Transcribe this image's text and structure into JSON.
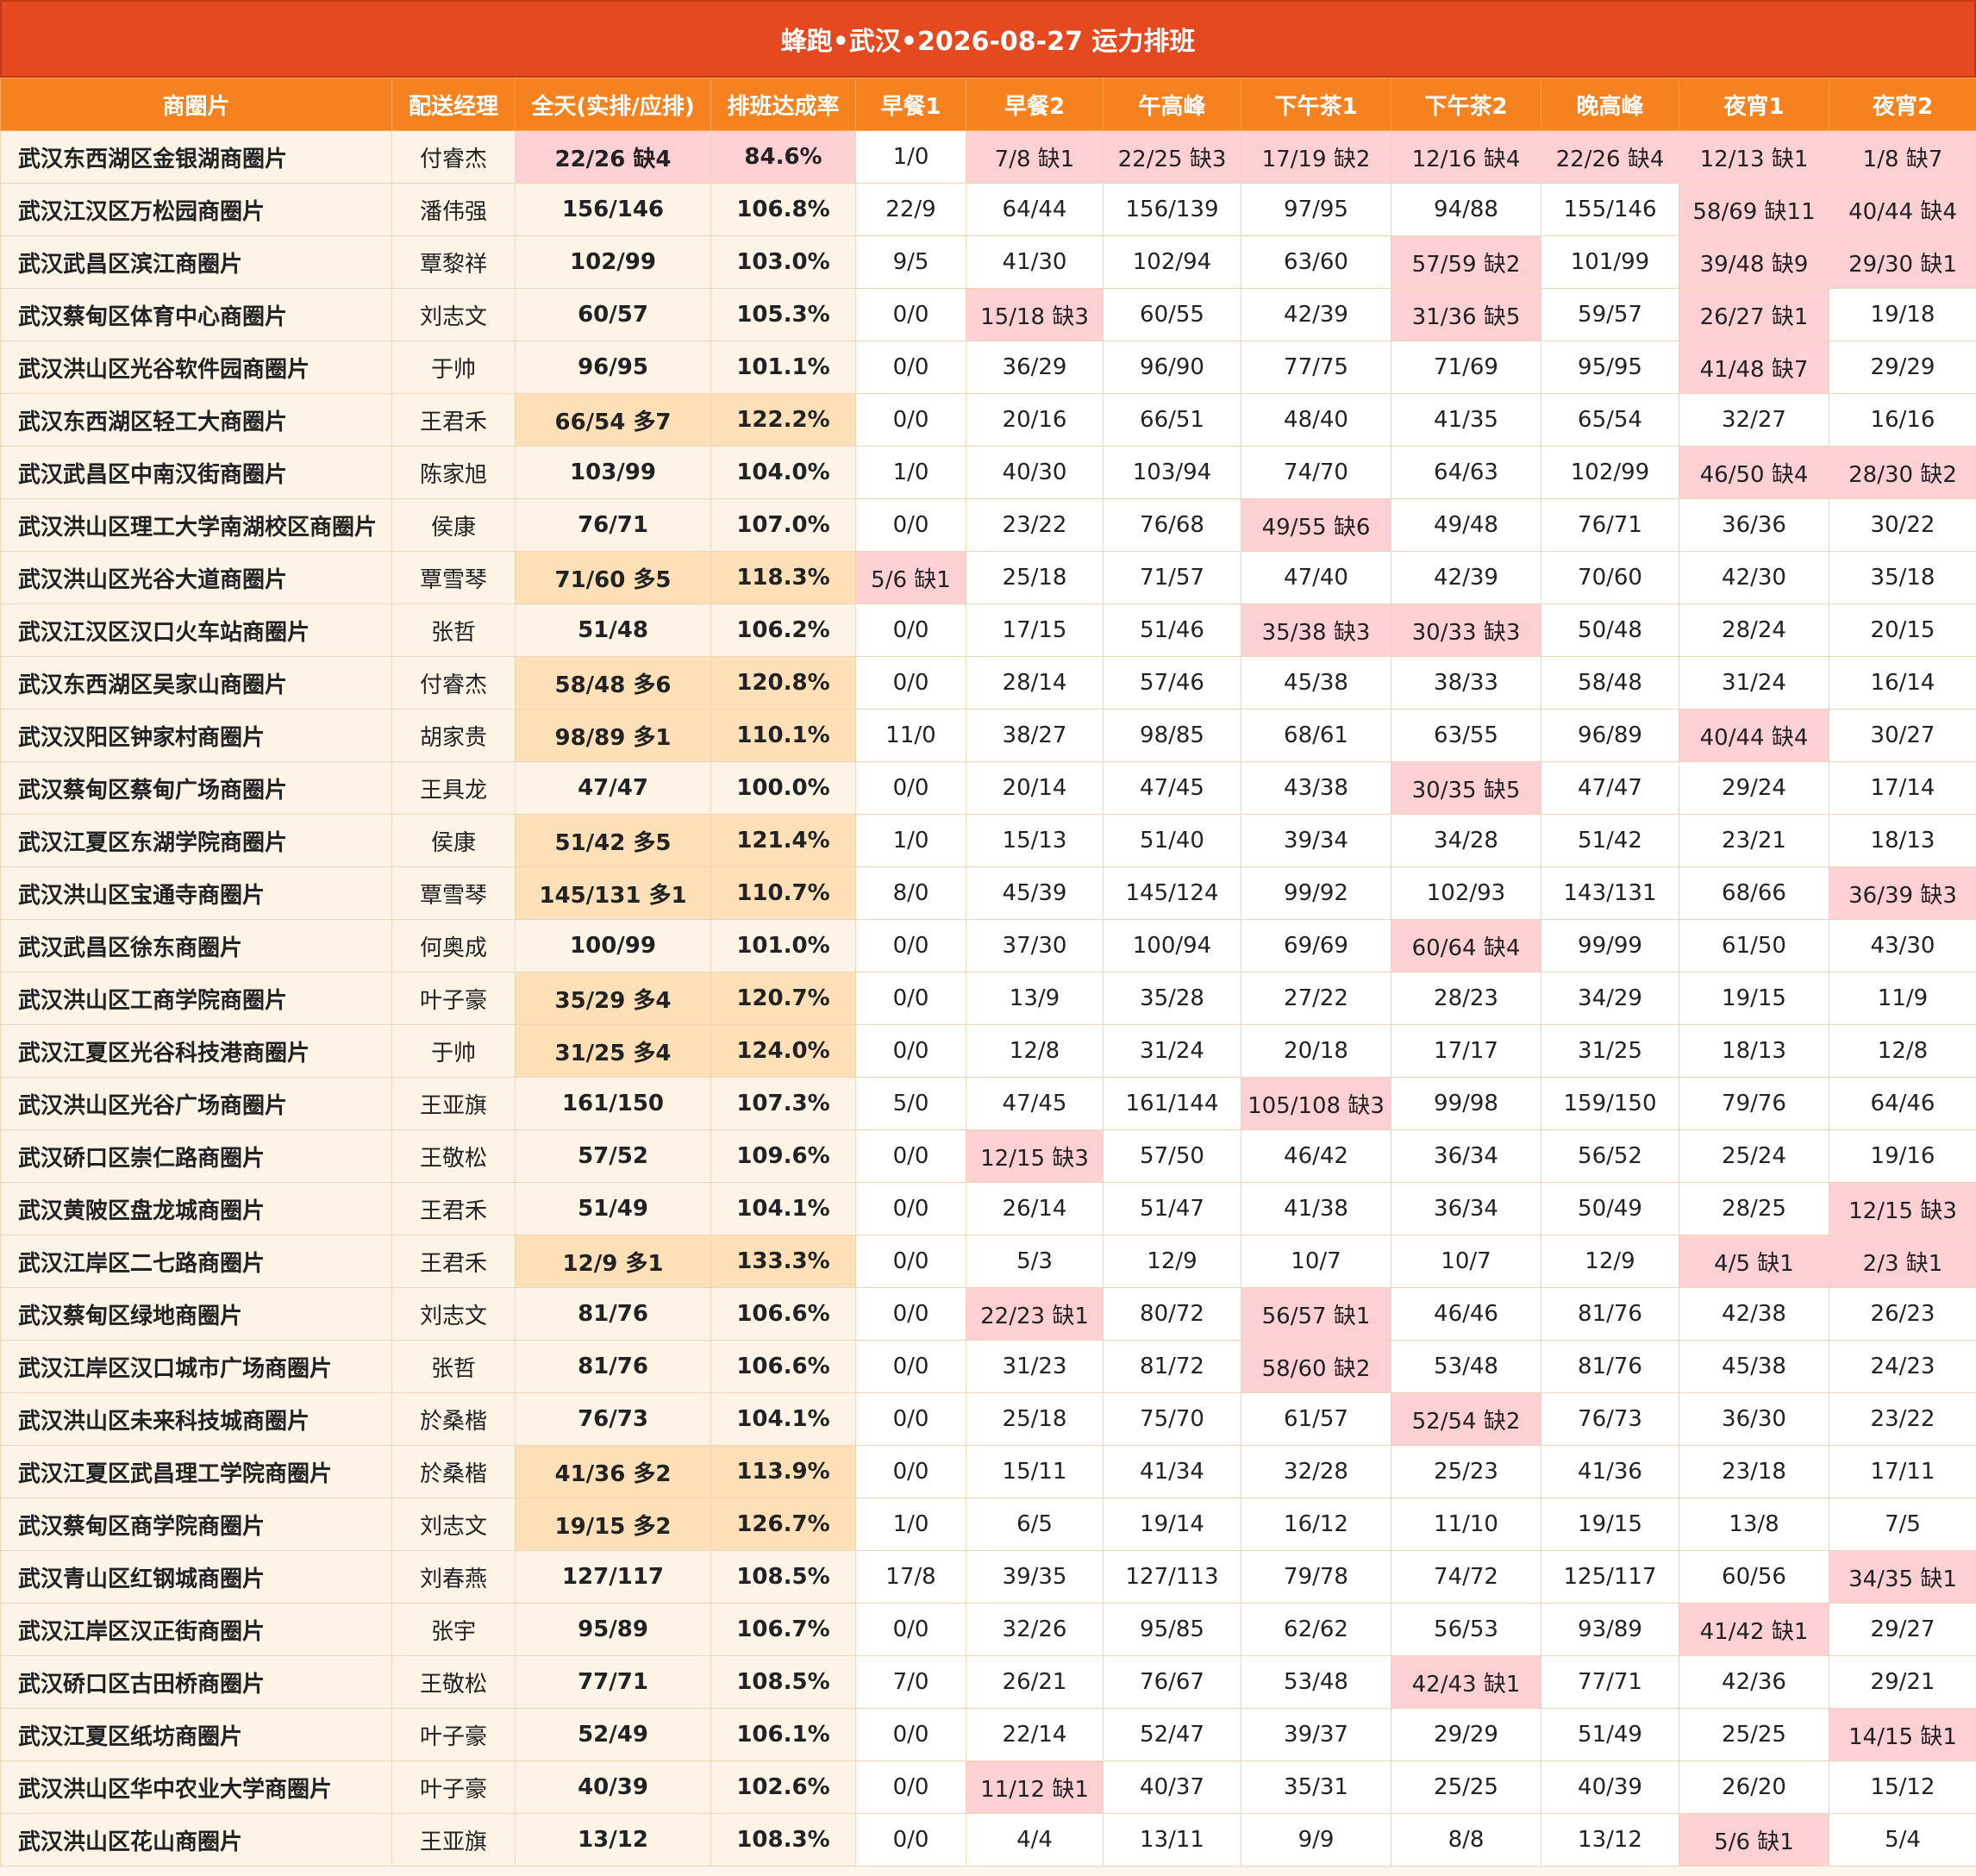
{
  "title": "蜂跑•武汉•2026-08-27 运力排班",
  "columns": [
    "商圈片",
    "配送经理",
    "全天(实排/应排)",
    "排班达成率",
    "早餐1",
    "早餐2",
    "午高峰",
    "下午茶1",
    "下午茶2",
    "晚高峰",
    "夜宵1",
    "夜宵2"
  ],
  "rows": [
    {
      "area": "武汉东西湖区金银湖商圈片",
      "manager": "付睿杰",
      "total": "22/26 缺4",
      "rate": "84.6%",
      "slots": [
        "1/0",
        "7/8 缺1",
        "22/25 缺3",
        "17/19 缺2",
        "12/16 缺4",
        "22/26 缺4",
        "12/13 缺1",
        "1/8 缺7"
      ]
    },
    {
      "area": "武汉江汉区万松园商圈片",
      "manager": "潘伟强",
      "total": "156/146",
      "rate": "106.8%",
      "slots": [
        "22/9",
        "64/44",
        "156/139",
        "97/95",
        "94/88",
        "155/146",
        "58/69 缺11",
        "40/44 缺4"
      ]
    },
    {
      "area": "武汉武昌区滨江商圈片",
      "manager": "覃黎祥",
      "total": "102/99",
      "rate": "103.0%",
      "slots": [
        "9/5",
        "41/30",
        "102/94",
        "63/60",
        "57/59 缺2",
        "101/99",
        "39/48 缺9",
        "29/30 缺1"
      ]
    },
    {
      "area": "武汉蔡甸区体育中心商圈片",
      "manager": "刘志文",
      "total": "60/57",
      "rate": "105.3%",
      "slots": [
        "0/0",
        "15/18 缺3",
        "60/55",
        "42/39",
        "31/36 缺5",
        "59/57",
        "26/27 缺1",
        "19/18"
      ]
    },
    {
      "area": "武汉洪山区光谷软件园商圈片",
      "manager": "于帅",
      "total": "96/95",
      "rate": "101.1%",
      "slots": [
        "0/0",
        "36/29",
        "96/90",
        "77/75",
        "71/69",
        "95/95",
        "41/48 缺7",
        "29/29"
      ]
    },
    {
      "area": "武汉东西湖区轻工大商圈片",
      "manager": "王君禾",
      "total": "66/54 多7",
      "rate": "122.2%",
      "slots": [
        "0/0",
        "20/16",
        "66/51",
        "48/40",
        "41/35",
        "65/54",
        "32/27",
        "16/16"
      ]
    },
    {
      "area": "武汉武昌区中南汉街商圈片",
      "manager": "陈家旭",
      "total": "103/99",
      "rate": "104.0%",
      "slots": [
        "1/0",
        "40/30",
        "103/94",
        "74/70",
        "64/63",
        "102/99",
        "46/50 缺4",
        "28/30 缺2"
      ]
    },
    {
      "area": "武汉洪山区理工大学南湖校区商圈片",
      "manager": "侯康",
      "total": "76/71",
      "rate": "107.0%",
      "slots": [
        "0/0",
        "23/22",
        "76/68",
        "49/55 缺6",
        "49/48",
        "76/71",
        "36/36",
        "30/22"
      ]
    },
    {
      "area": "武汉洪山区光谷大道商圈片",
      "manager": "覃雪琴",
      "total": "71/60 多5",
      "rate": "118.3%",
      "slots": [
        "5/6 缺1",
        "25/18",
        "71/57",
        "47/40",
        "42/39",
        "70/60",
        "42/30",
        "35/18"
      ]
    },
    {
      "area": "武汉江汉区汉口火车站商圈片",
      "manager": "张哲",
      "total": "51/48",
      "rate": "106.2%",
      "slots": [
        "0/0",
        "17/15",
        "51/46",
        "35/38 缺3",
        "30/33 缺3",
        "50/48",
        "28/24",
        "20/15"
      ]
    },
    {
      "area": "武汉东西湖区吴家山商圈片",
      "manager": "付睿杰",
      "total": "58/48 多6",
      "rate": "120.8%",
      "slots": [
        "0/0",
        "28/14",
        "57/46",
        "45/38",
        "38/33",
        "58/48",
        "31/24",
        "16/14"
      ]
    },
    {
      "area": "武汉汉阳区钟家村商圈片",
      "manager": "胡家贵",
      "total": "98/89 多1",
      "rate": "110.1%",
      "slots": [
        "11/0",
        "38/27",
        "98/85",
        "68/61",
        "63/55",
        "96/89",
        "40/44 缺4",
        "30/27"
      ]
    },
    {
      "area": "武汉蔡甸区蔡甸广场商圈片",
      "manager": "王具龙",
      "total": "47/47",
      "rate": "100.0%",
      "slots": [
        "0/0",
        "20/14",
        "47/45",
        "43/38",
        "30/35 缺5",
        "47/47",
        "29/24",
        "17/14"
      ]
    },
    {
      "area": "武汉江夏区东湖学院商圈片",
      "manager": "侯康",
      "total": "51/42 多5",
      "rate": "121.4%",
      "slots": [
        "1/0",
        "15/13",
        "51/40",
        "39/34",
        "34/28",
        "51/42",
        "23/21",
        "18/13"
      ]
    },
    {
      "area": "武汉洪山区宝通寺商圈片",
      "manager": "覃雪琴",
      "total": "145/131 多1",
      "rate": "110.7%",
      "slots": [
        "8/0",
        "45/39",
        "145/124",
        "99/92",
        "102/93",
        "143/131",
        "68/66",
        "36/39 缺3"
      ]
    },
    {
      "area": "武汉武昌区徐东商圈片",
      "manager": "何奥成",
      "total": "100/99",
      "rate": "101.0%",
      "slots": [
        "0/0",
        "37/30",
        "100/94",
        "69/69",
        "60/64 缺4",
        "99/99",
        "61/50",
        "43/30"
      ]
    },
    {
      "area": "武汉洪山区工商学院商圈片",
      "manager": "叶子豪",
      "total": "35/29 多4",
      "rate": "120.7%",
      "slots": [
        "0/0",
        "13/9",
        "35/28",
        "27/22",
        "28/23",
        "34/29",
        "19/15",
        "11/9"
      ]
    },
    {
      "area": "武汉江夏区光谷科技港商圈片",
      "manager": "于帅",
      "total": "31/25 多4",
      "rate": "124.0%",
      "slots": [
        "0/0",
        "12/8",
        "31/24",
        "20/18",
        "17/17",
        "31/25",
        "18/13",
        "12/8"
      ]
    },
    {
      "area": "武汉洪山区光谷广场商圈片",
      "manager": "王亚旗",
      "total": "161/150",
      "rate": "107.3%",
      "slots": [
        "5/0",
        "47/45",
        "161/144",
        "105/108 缺3",
        "99/98",
        "159/150",
        "79/76",
        "64/46"
      ]
    },
    {
      "area": "武汉硚口区崇仁路商圈片",
      "manager": "王敬松",
      "total": "57/52",
      "rate": "109.6%",
      "slots": [
        "0/0",
        "12/15 缺3",
        "57/50",
        "46/42",
        "36/34",
        "56/52",
        "25/24",
        "19/16"
      ]
    },
    {
      "area": "武汉黄陂区盘龙城商圈片",
      "manager": "王君禾",
      "total": "51/49",
      "rate": "104.1%",
      "slots": [
        "0/0",
        "26/14",
        "51/47",
        "41/38",
        "36/34",
        "50/49",
        "28/25",
        "12/15 缺3"
      ]
    },
    {
      "area": "武汉江岸区二七路商圈片",
      "manager": "王君禾",
      "total": "12/9 多1",
      "rate": "133.3%",
      "slots": [
        "0/0",
        "5/3",
        "12/9",
        "10/7",
        "10/7",
        "12/9",
        "4/5 缺1",
        "2/3 缺1"
      ]
    },
    {
      "area": "武汉蔡甸区绿地商圈片",
      "manager": "刘志文",
      "total": "81/76",
      "rate": "106.6%",
      "slots": [
        "0/0",
        "22/23 缺1",
        "80/72",
        "56/57 缺1",
        "46/46",
        "81/76",
        "42/38",
        "26/23"
      ]
    },
    {
      "area": "武汉江岸区汉口城市广场商圈片",
      "manager": "张哲",
      "total": "81/76",
      "rate": "106.6%",
      "slots": [
        "0/0",
        "31/23",
        "81/72",
        "58/60 缺2",
        "53/48",
        "81/76",
        "45/38",
        "24/23"
      ]
    },
    {
      "area": "武汉洪山区未来科技城商圈片",
      "manager": "於桑楷",
      "total": "76/73",
      "rate": "104.1%",
      "slots": [
        "0/0",
        "25/18",
        "75/70",
        "61/57",
        "52/54 缺2",
        "76/73",
        "36/30",
        "23/22"
      ]
    },
    {
      "area": "武汉江夏区武昌理工学院商圈片",
      "manager": "於桑楷",
      "total": "41/36 多2",
      "rate": "113.9%",
      "slots": [
        "0/0",
        "15/11",
        "41/34",
        "32/28",
        "25/23",
        "41/36",
        "23/18",
        "17/11"
      ]
    },
    {
      "area": "武汉蔡甸区商学院商圈片",
      "manager": "刘志文",
      "total": "19/15 多2",
      "rate": "126.7%",
      "slots": [
        "1/0",
        "6/5",
        "19/14",
        "16/12",
        "11/10",
        "19/15",
        "13/8",
        "7/5"
      ]
    },
    {
      "area": "武汉青山区红钢城商圈片",
      "manager": "刘春燕",
      "total": "127/117",
      "rate": "108.5%",
      "slots": [
        "17/8",
        "39/35",
        "127/113",
        "79/78",
        "74/72",
        "125/117",
        "60/56",
        "34/35 缺1"
      ]
    },
    {
      "area": "武汉江岸区汉正街商圈片",
      "manager": "张宇",
      "total": "95/89",
      "rate": "106.7%",
      "slots": [
        "0/0",
        "32/26",
        "95/85",
        "62/62",
        "56/53",
        "93/89",
        "41/42 缺1",
        "29/27"
      ]
    },
    {
      "area": "武汉硚口区古田桥商圈片",
      "manager": "王敬松",
      "total": "77/71",
      "rate": "108.5%",
      "slots": [
        "7/0",
        "26/21",
        "76/67",
        "53/48",
        "42/43 缺1",
        "77/71",
        "42/36",
        "29/21"
      ]
    },
    {
      "area": "武汉江夏区纸坊商圈片",
      "manager": "叶子豪",
      "total": "52/49",
      "rate": "106.1%",
      "slots": [
        "0/0",
        "22/14",
        "52/47",
        "39/37",
        "29/29",
        "51/49",
        "25/25",
        "14/15 缺1"
      ]
    },
    {
      "area": "武汉洪山区华中农业大学商圈片",
      "manager": "叶子豪",
      "total": "40/39",
      "rate": "102.6%",
      "slots": [
        "0/0",
        "11/12 缺1",
        "40/37",
        "35/31",
        "25/25",
        "40/39",
        "26/20",
        "15/12"
      ]
    },
    {
      "area": "武汉洪山区花山商圈片",
      "manager": "王亚旗",
      "total": "13/12",
      "rate": "108.3%",
      "slots": [
        "0/0",
        "4/4",
        "13/11",
        "9/9",
        "8/8",
        "13/12",
        "5/6 缺1",
        "5/4"
      ]
    }
  ],
  "colors": {
    "title_bg": "#e4491f",
    "header_bg": "#f6821f",
    "shortage_bg": "#fdd1d4",
    "surplus_bg": "#fde0b8",
    "info_bg": "#fdf3e6"
  }
}
